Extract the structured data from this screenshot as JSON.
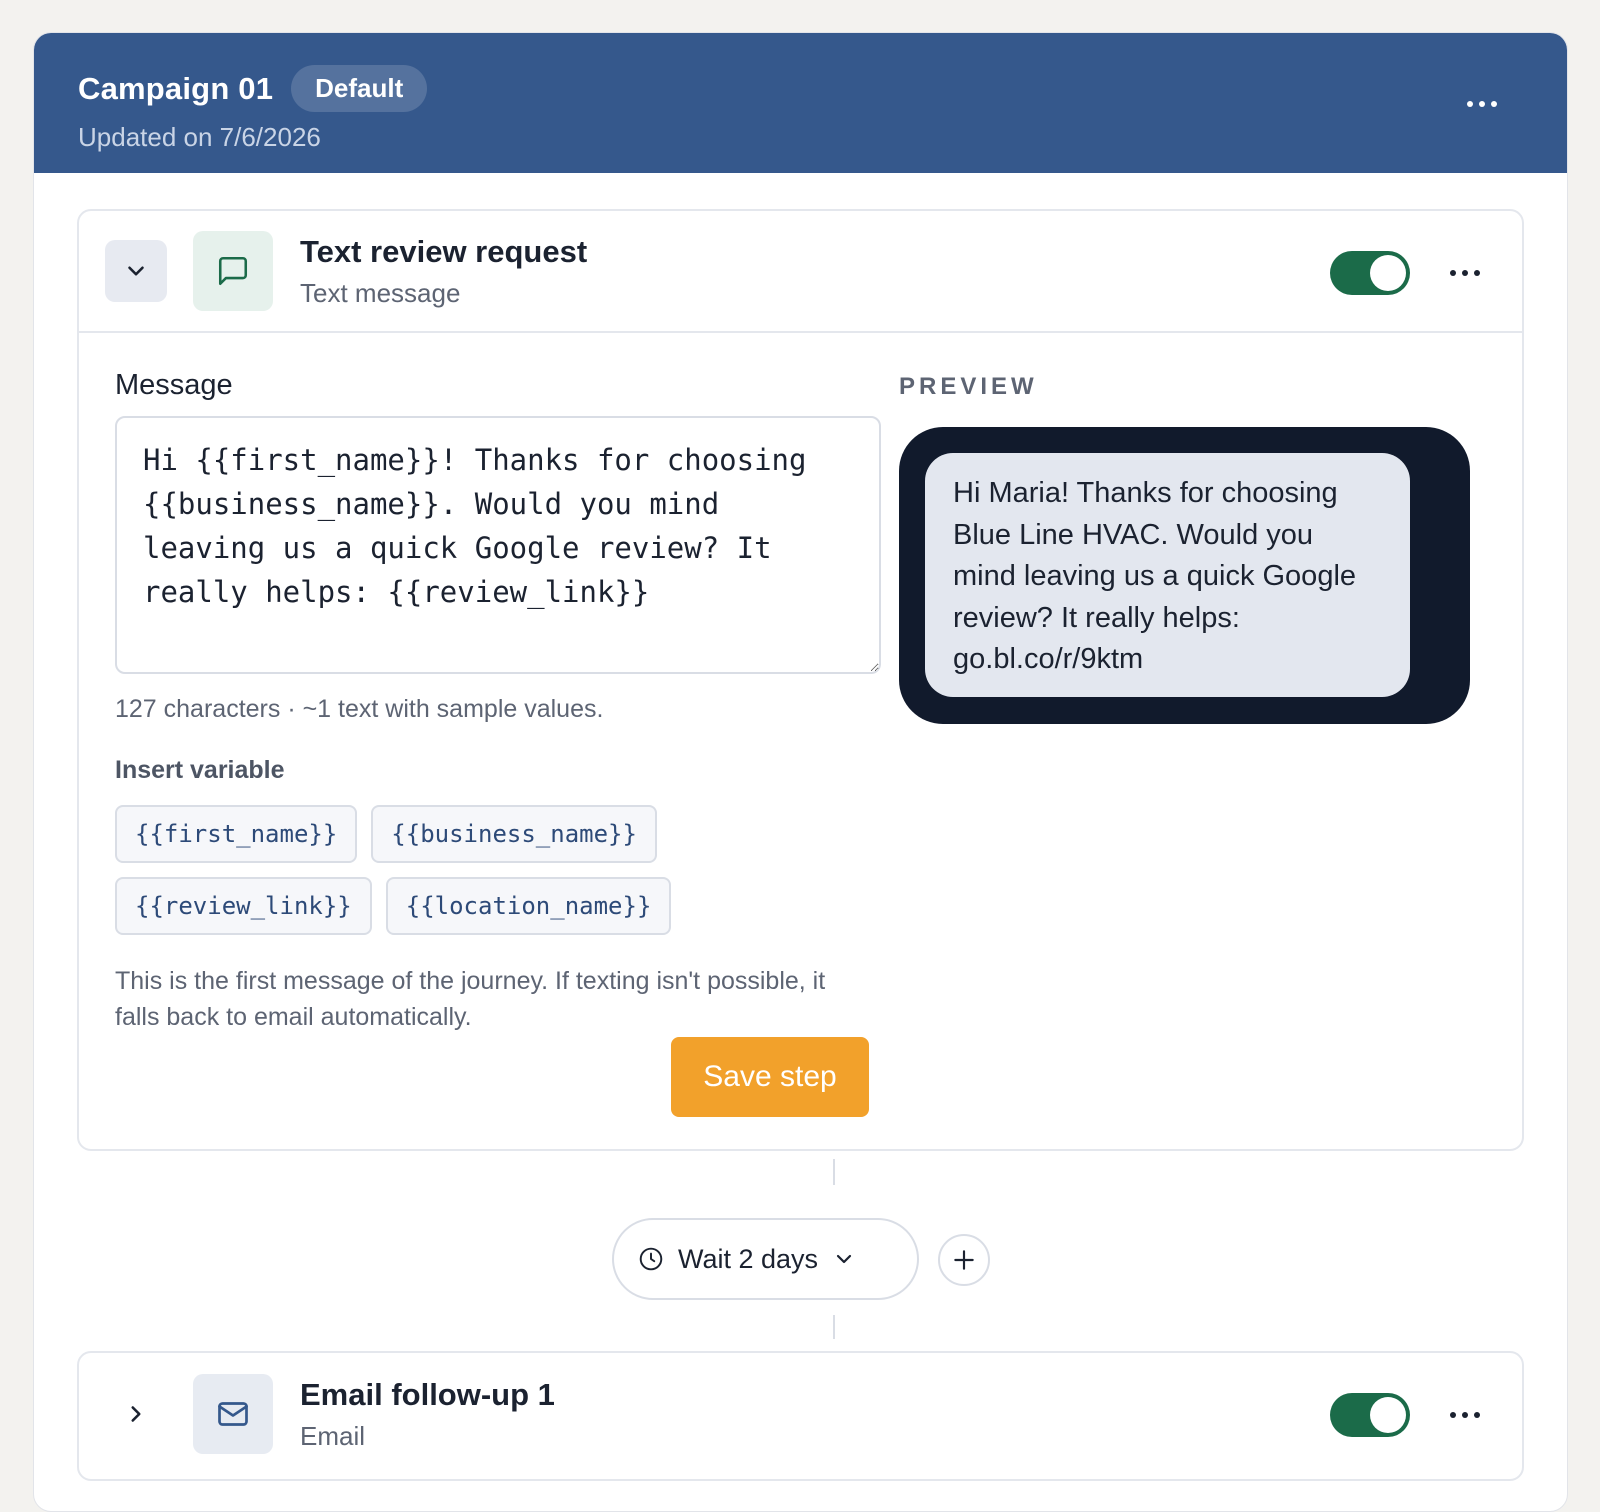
{
  "campaign": {
    "title": "Campaign 01",
    "badge": "Default",
    "updated": "Updated on 7/6/2026"
  },
  "step1": {
    "title": "Text review request",
    "subtitle": "Text message",
    "enabled": true,
    "message_label": "Message",
    "message_value": "Hi {{first_name}}! Thanks for choosing {{business_name}}. Would you mind leaving us a quick Google review? It really helps: {{review_link}}",
    "char_count": "127 characters · ~1 text with sample values.",
    "insert_label": "Insert variable",
    "variables": [
      "{{first_name}}",
      "{{business_name}}",
      "{{review_link}}",
      "{{location_name}}"
    ],
    "note": "This is the first message of the journey. If texting isn't possible, it falls back to email automatically.",
    "save_label": "Save step",
    "preview_label": "PREVIEW",
    "preview_text": "Hi Maria! Thanks for choosing Blue Line HVAC. Would you mind leaving us a quick Google review? It really helps: go.bl.co/r/9ktm"
  },
  "wait": {
    "label": "Wait 2 days"
  },
  "step2": {
    "title": "Email follow-up 1",
    "subtitle": "Email",
    "enabled": true
  },
  "icons": {
    "header_more": "more-horizontal-icon",
    "collapse": "chevron-down-icon",
    "expand": "chevron-right-icon",
    "sms": "message-square-icon",
    "email": "mail-icon",
    "clock": "clock-icon",
    "add": "plus-icon"
  },
  "colors": {
    "header": "#35588c",
    "toggle_on": "#1b6b49",
    "save": "#f2a12b",
    "phone": "#111a2c"
  }
}
